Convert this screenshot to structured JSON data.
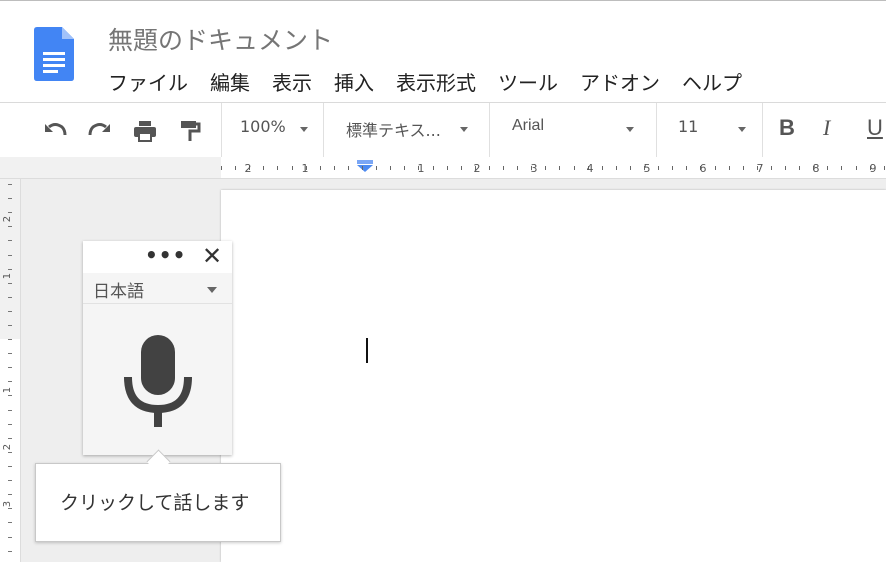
{
  "doc": {
    "title": "無題のドキュメント"
  },
  "menu": [
    "ファイル",
    "編集",
    "表示",
    "挿入",
    "表示形式",
    "ツール",
    "アドオン",
    "ヘルプ"
  ],
  "toolbar": {
    "zoom": "100%",
    "style": "標準テキス...",
    "font": "Arial",
    "size": "11",
    "bold": "B",
    "italic": "I",
    "underline": "U"
  },
  "ruler": {
    "h_labels": [
      "2",
      "1",
      "1",
      "2",
      "3",
      "4",
      "5",
      "6",
      "7",
      "8",
      "9"
    ],
    "v_labels": [
      "2",
      "1",
      "1",
      "2",
      "3"
    ]
  },
  "voice": {
    "language": "日本語",
    "tooltip": "クリックして話します"
  },
  "colors": {
    "doc_icon": "#4285f4",
    "mic": "#424242"
  }
}
